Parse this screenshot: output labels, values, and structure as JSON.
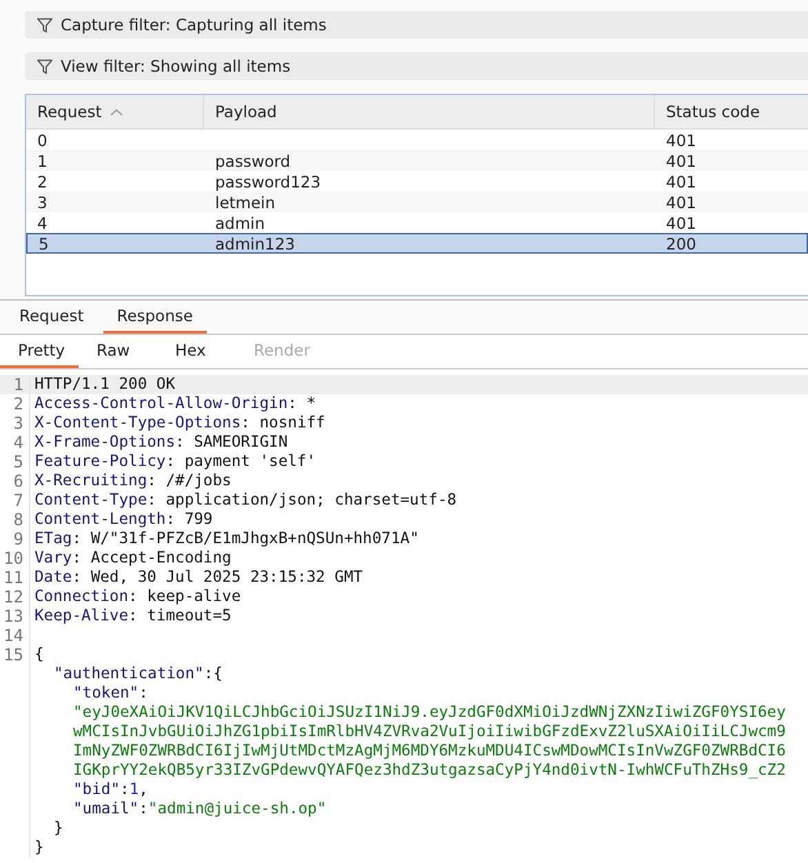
{
  "filters": [
    {
      "label": "Capture filter: Capturing all items"
    },
    {
      "label": "View filter: Showing all items"
    }
  ],
  "table": {
    "columns": [
      {
        "label": "Request",
        "sorted": true
      },
      {
        "label": "Payload",
        "sorted": false
      },
      {
        "label": "Status code",
        "sorted": false
      }
    ],
    "rows": [
      {
        "cells": [
          "0",
          "",
          "401"
        ],
        "selected": false
      },
      {
        "cells": [
          "1",
          "password",
          "401"
        ],
        "selected": false
      },
      {
        "cells": [
          "2",
          "password123",
          "401"
        ],
        "selected": false
      },
      {
        "cells": [
          "3",
          "letmein",
          "401"
        ],
        "selected": false
      },
      {
        "cells": [
          "4",
          "admin",
          "401"
        ],
        "selected": false
      },
      {
        "cells": [
          "5",
          "admin123",
          "200"
        ],
        "selected": true
      }
    ]
  },
  "tabs": [
    {
      "label": "Request",
      "selected": false
    },
    {
      "label": "Response",
      "selected": true
    }
  ],
  "view_tabs": [
    {
      "label": "Pretty",
      "selected": true,
      "disabled": false
    },
    {
      "label": "Raw",
      "selected": false,
      "disabled": false
    },
    {
      "label": "Hex",
      "selected": false,
      "disabled": false
    },
    {
      "label": "Render",
      "selected": false,
      "disabled": true
    }
  ],
  "lines": [
    {
      "number": "1",
      "kind": "top",
      "segments": [
        {
          "kind": "plain",
          "text": "HTTP/1.1 200 OK"
        }
      ]
    },
    {
      "number": "2",
      "kind": "top",
      "segments": [
        {
          "kind": "header",
          "text": "Access-Control-Allow-Origin"
        },
        {
          "kind": "plain",
          "text": ": *"
        }
      ]
    },
    {
      "number": "3",
      "kind": "top",
      "segments": [
        {
          "kind": "header",
          "text": "X-Content-Type-Options"
        },
        {
          "kind": "plain",
          "text": ": nosniff"
        }
      ]
    },
    {
      "number": "4",
      "kind": "top",
      "segments": [
        {
          "kind": "header",
          "text": "X-Frame-Options"
        },
        {
          "kind": "plain",
          "text": ": SAMEORIGIN"
        }
      ]
    },
    {
      "number": "5",
      "kind": "top",
      "segments": [
        {
          "kind": "header",
          "text": "Feature-Policy"
        },
        {
          "kind": "plain",
          "text": ": payment 'self'"
        }
      ]
    },
    {
      "number": "6",
      "kind": "top",
      "segments": [
        {
          "kind": "header",
          "text": "X-Recruiting"
        },
        {
          "kind": "plain",
          "text": ": /#/jobs"
        }
      ]
    },
    {
      "number": "7",
      "kind": "top",
      "segments": [
        {
          "kind": "header",
          "text": "Content-Type"
        },
        {
          "kind": "plain",
          "text": ": application/json; charset=utf-8"
        }
      ]
    },
    {
      "number": "8",
      "kind": "top",
      "segments": [
        {
          "kind": "header",
          "text": "Content-Length"
        },
        {
          "kind": "plain",
          "text": ": 799"
        }
      ]
    },
    {
      "number": "9",
      "kind": "top",
      "segments": [
        {
          "kind": "header",
          "text": "ETag"
        },
        {
          "kind": "plain",
          "text": ": W/\"31f-PFZcB/E1mJhgxB+nQSUn+hh071A\""
        }
      ]
    },
    {
      "number": "10",
      "kind": "top",
      "segments": [
        {
          "kind": "header",
          "text": "Vary"
        },
        {
          "kind": "plain",
          "text": ": Accept-Encoding"
        }
      ]
    },
    {
      "number": "11",
      "kind": "top",
      "segments": [
        {
          "kind": "header",
          "text": "Date"
        },
        {
          "kind": "plain",
          "text": ": Wed, 30 Jul 2025 23:15:32 GMT"
        }
      ]
    },
    {
      "number": "12",
      "kind": "top",
      "segments": [
        {
          "kind": "header",
          "text": "Connection"
        },
        {
          "kind": "plain",
          "text": ": keep-alive"
        }
      ]
    },
    {
      "number": "13",
      "kind": "top",
      "segments": [
        {
          "kind": "header",
          "text": "Keep-Alive"
        },
        {
          "kind": "plain",
          "text": ": timeout=5"
        }
      ]
    },
    {
      "number": "14"
    },
    {
      "number": "15",
      "kind": "top",
      "segments": [
        {
          "kind": "plain",
          "text": "{"
        }
      ]
    },
    {
      "kind": "member",
      "segments": [
        {
          "kind": "header",
          "text": "\"authentication\""
        },
        {
          "kind": "plain",
          "text": ":{"
        }
      ]
    },
    {
      "kind": "nested",
      "segments": [
        {
          "kind": "header",
          "text": "\"token\""
        },
        {
          "kind": "plain",
          "text": ":"
        }
      ]
    },
    {
      "kind": "nested",
      "segments": [
        {
          "kind": "string",
          "text": "\"eyJ0eXAiOiJKV1QiLCJhbGciOiJSUzI1NiJ9.eyJzdGF0dXMiOiJzdWNjZXNzIiwiZGF0YSI6ey"
        }
      ]
    },
    {
      "kind": "nested",
      "segments": [
        {
          "kind": "string",
          "text": "wMCIsInJvbGUiOiJhZG1pbiIsImRlbHV4ZVRva2VuIjoiIiwibGFzdExvZ2luSXAiOiIiLCJwcm9"
        }
      ]
    },
    {
      "kind": "nested",
      "segments": [
        {
          "kind": "string",
          "text": "ImNyZWF0ZWRBdCI6IjIwMjUtMDctMzAgMjM6MDY6MzkuMDU4ICswMDowMCIsInVwZGF0ZWRBdCI6"
        }
      ]
    },
    {
      "kind": "nested",
      "segments": [
        {
          "kind": "string",
          "text": "IGKprYY2ekQB5yr33IZvGPdewvQYAFQez3hdZ3utgazsaCyPjY4nd0ivtN-IwhWCFuThZHs9_cZ2"
        }
      ]
    },
    {
      "kind": "nested",
      "segments": [
        {
          "kind": "header",
          "text": "\"bid\""
        },
        {
          "kind": "plain",
          "text": ":"
        },
        {
          "kind": "number",
          "text": "1"
        },
        {
          "kind": "plain",
          "text": ","
        }
      ]
    },
    {
      "kind": "nested",
      "segments": [
        {
          "kind": "header",
          "text": "\"umail\""
        },
        {
          "kind": "plain",
          "text": ":"
        },
        {
          "kind": "string",
          "text": "\"admin@juice-sh.op\""
        }
      ]
    },
    {
      "kind": "member",
      "segments": [
        {
          "kind": "plain",
          "text": "}"
        }
      ]
    },
    {
      "kind": "top",
      "segments": [
        {
          "kind": "plain",
          "text": "}"
        }
      ]
    }
  ]
}
